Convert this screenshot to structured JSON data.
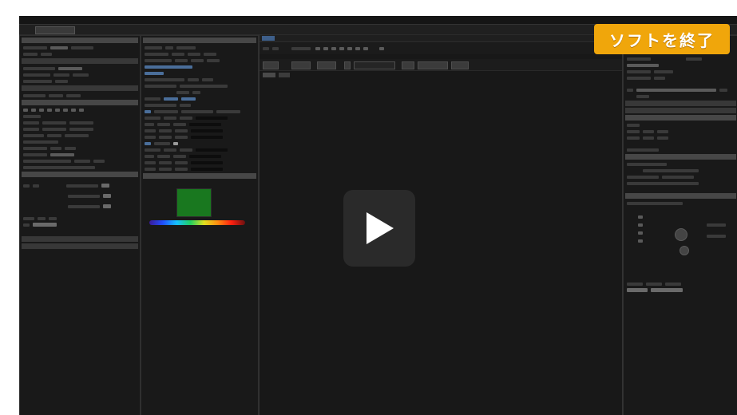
{
  "overlay": {
    "banner_text": "ソフトを終了",
    "banner_color": "#f0a60b",
    "play_icon": "play-icon"
  },
  "colors": {
    "app_bg": "#1d1d1d",
    "panel_bg": "#191919",
    "header": "#474747",
    "accent_blue": "#4a6e9a",
    "swatch_green": "#19781f"
  }
}
